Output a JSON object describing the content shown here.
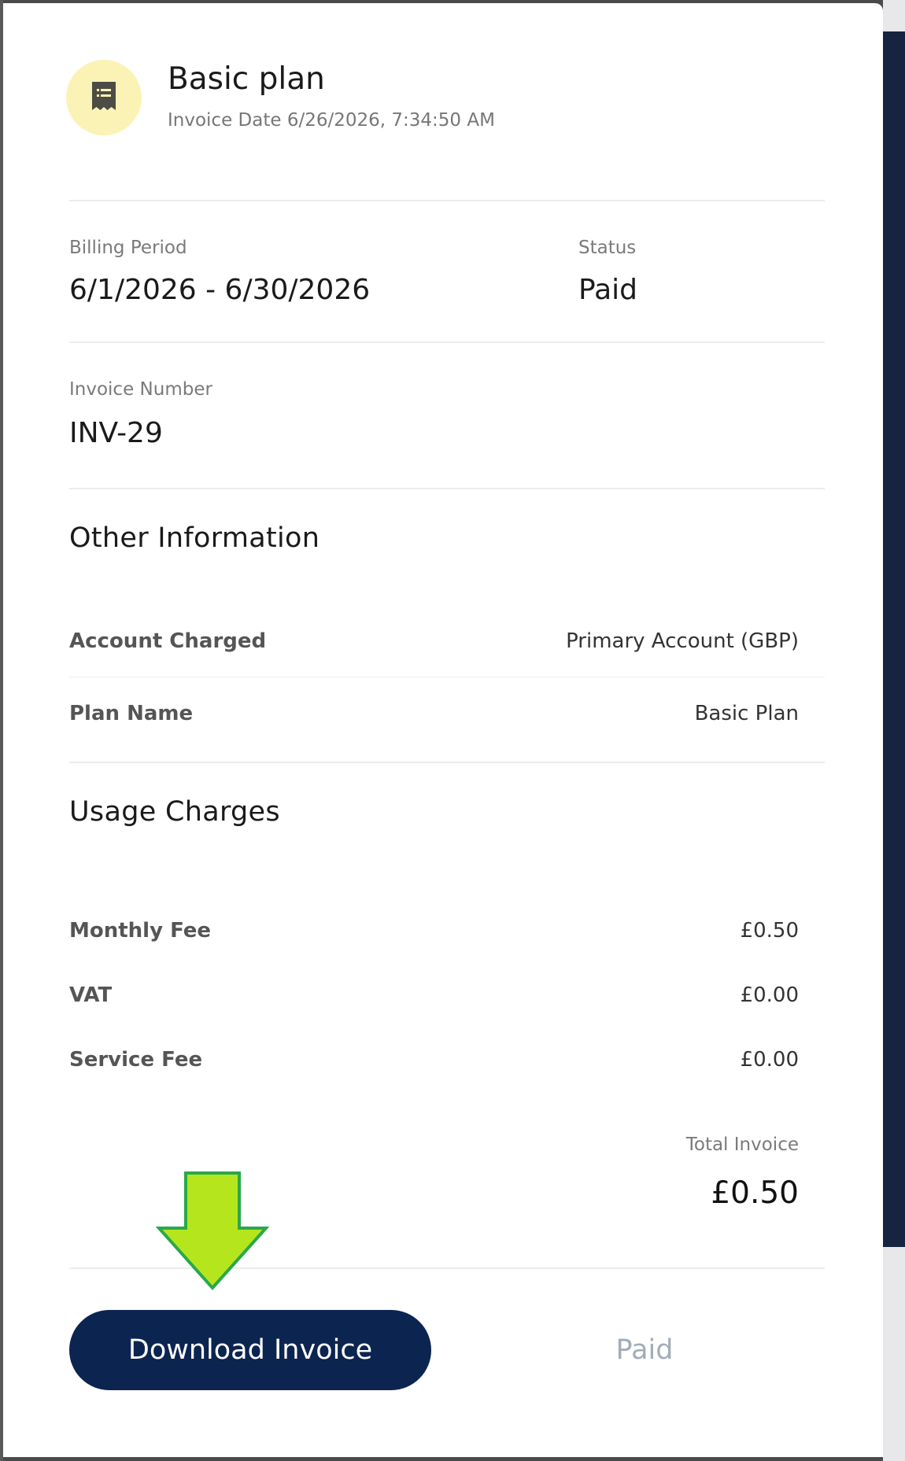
{
  "invoice": {
    "plan_title": "Basic plan",
    "invoice_date": "Invoice Date 6/26/2026, 7:34:50 AM",
    "billing_period_label": "Billing Period",
    "billing_period_value": "6/1/2026 - 6/30/2026",
    "status_label": "Status",
    "status_value": "Paid",
    "invoice_number_label": "Invoice Number",
    "invoice_number_value": "INV-29"
  },
  "other_information": {
    "title": "Other Information",
    "rows": [
      {
        "label": "Account Charged",
        "value": "Primary Account (GBP)"
      },
      {
        "label": "Plan Name",
        "value": "Basic Plan"
      }
    ]
  },
  "usage_charges": {
    "title": "Usage Charges",
    "rows": [
      {
        "label": "Monthly Fee",
        "value": "£0.50"
      },
      {
        "label": "VAT",
        "value": "£0.00"
      },
      {
        "label": "Service Fee",
        "value": "£0.00"
      }
    ],
    "total_label": "Total Invoice",
    "total_value": "£0.50"
  },
  "actions": {
    "download_label": "Download Invoice",
    "paid_label": "Paid"
  },
  "icons": {
    "header_icon": "receipt-icon",
    "annotation": "arrow-down-icon"
  },
  "colors": {
    "primary_button": "#0c2450",
    "icon_background": "#fbf3b6",
    "annotation_arrow": "#b5e61d"
  }
}
